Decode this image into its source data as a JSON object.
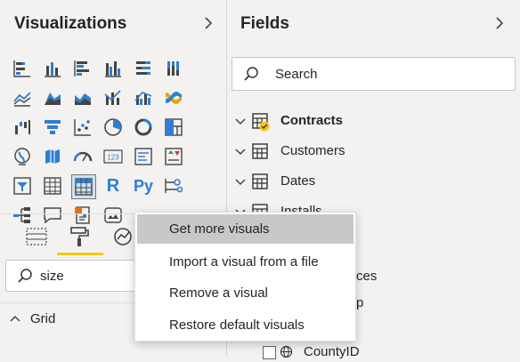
{
  "visualizations": {
    "title": "Visualizations",
    "tabs": [
      "build-visual",
      "format-visual",
      "analytics"
    ],
    "format_search": {
      "value": "size"
    },
    "section": {
      "label": "Grid"
    }
  },
  "fields": {
    "title": "Fields",
    "search": {
      "placeholder": "Search"
    },
    "tables": [
      {
        "label": "Contracts",
        "bold": true
      },
      {
        "label": "Customers",
        "bold": false
      },
      {
        "label": "Dates",
        "bold": false
      },
      {
        "label": "Installs",
        "bold": false
      }
    ],
    "partial_labels": [
      "ces",
      "p"
    ],
    "field": {
      "label": "CountyID"
    }
  },
  "context_menu": {
    "items": [
      {
        "label": "Get more visuals",
        "highlighted": true
      },
      {
        "label": "Import a visual from a file",
        "highlighted": false
      },
      {
        "label": "Remove a visual",
        "highlighted": false
      },
      {
        "label": "Restore default visuals",
        "highlighted": false
      }
    ]
  },
  "icon_labels": {
    "r_visual": "R",
    "python_visual": "Py",
    "more": "···"
  },
  "colors": {
    "accent": "#f2c811",
    "viz_blue": "#2e7fd0",
    "menu_hover": "#c8c8c8"
  }
}
